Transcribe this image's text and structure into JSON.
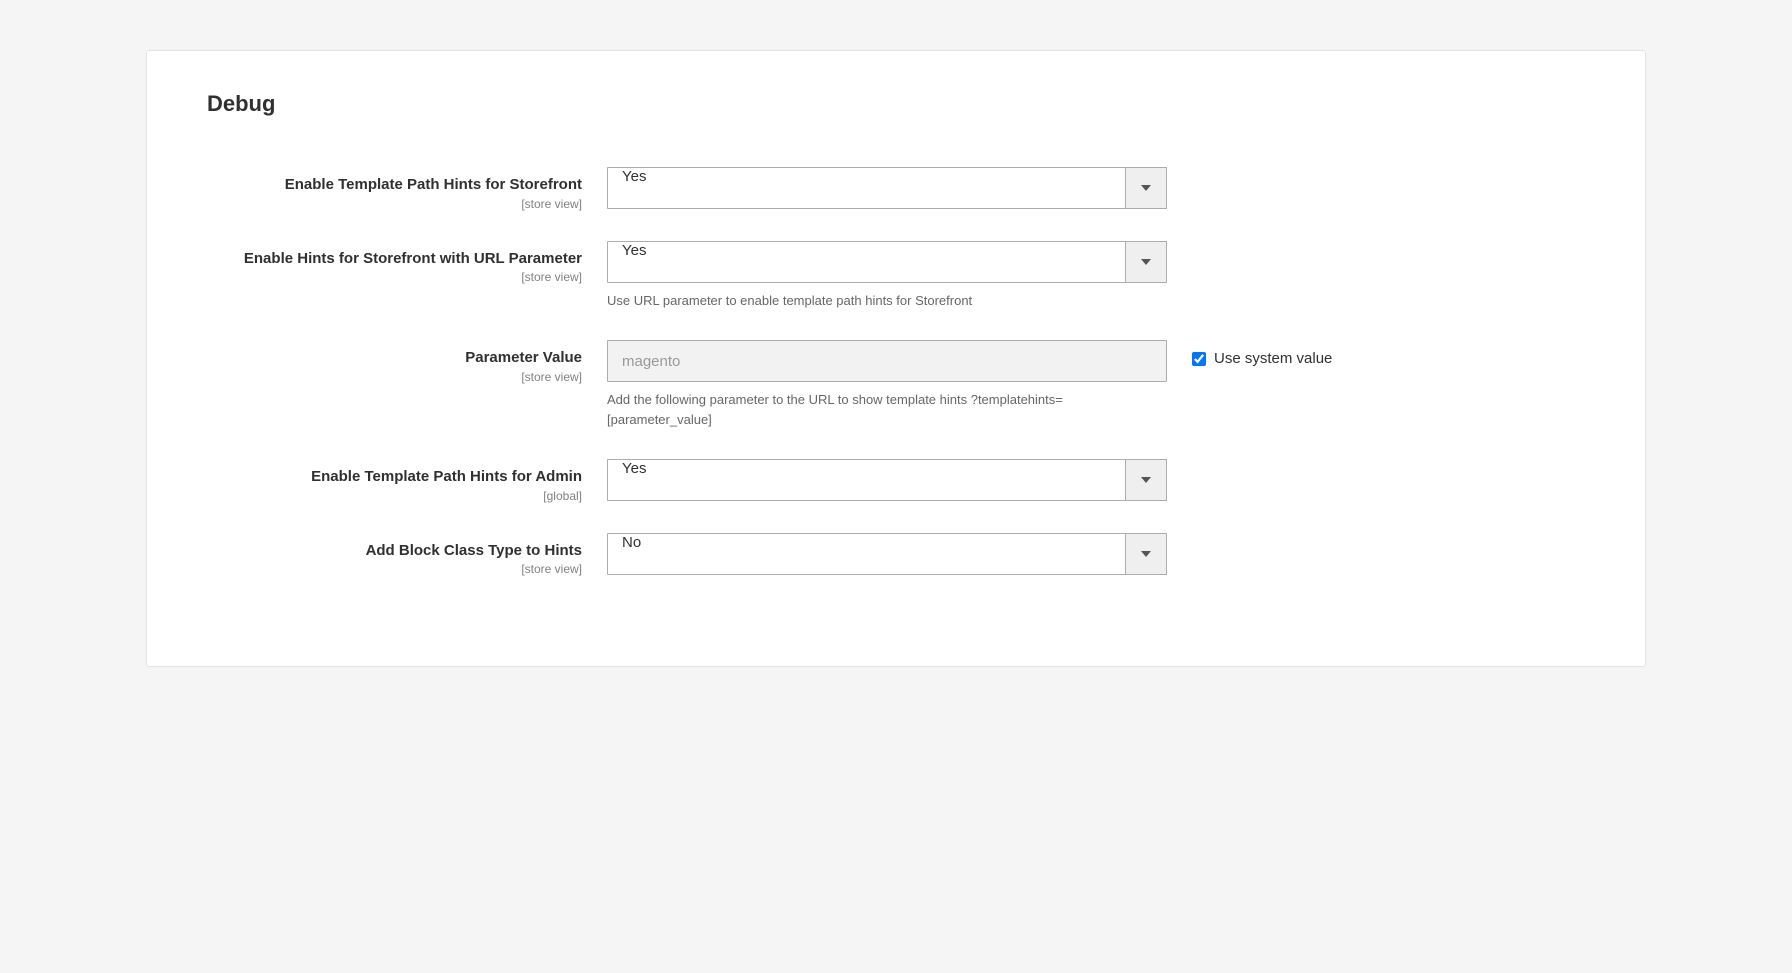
{
  "section": {
    "title": "Debug"
  },
  "fields": {
    "storefront_hints": {
      "label": "Enable Template Path Hints for Storefront",
      "scope": "[store view]",
      "value": "Yes"
    },
    "url_parameter_hints": {
      "label": "Enable Hints for Storefront with URL Parameter",
      "scope": "[store view]",
      "value": "Yes",
      "hint": "Use URL parameter to enable template path hints for Storefront"
    },
    "parameter_value": {
      "label": "Parameter Value",
      "scope": "[store view]",
      "value": "magento",
      "hint": "Add the following parameter to the URL to show template hints ?templatehints=[parameter_value]",
      "use_system_label": "Use system value"
    },
    "admin_hints": {
      "label": "Enable Template Path Hints for Admin",
      "scope": "[global]",
      "value": "Yes"
    },
    "block_class_hints": {
      "label": "Add Block Class Type to Hints",
      "scope": "[store view]",
      "value": "No"
    }
  }
}
